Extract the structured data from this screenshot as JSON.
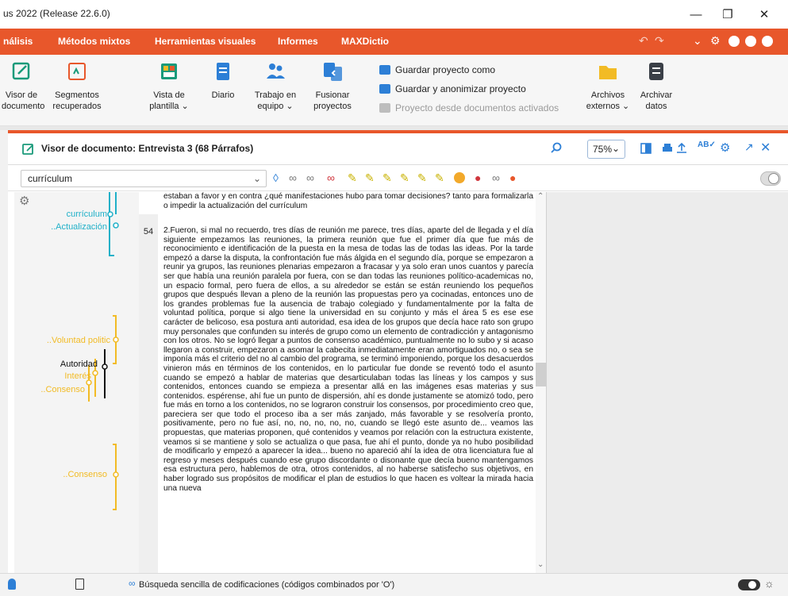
{
  "window": {
    "title": "us 2022 (Release 22.6.0)"
  },
  "menu": [
    "nálisis",
    "Métodos mixtos",
    "Herramientas visuales",
    "Informes",
    "MAXDictio"
  ],
  "ribbon": {
    "buttons": [
      {
        "line1": "Visor de",
        "line2": "documento"
      },
      {
        "line1": "Segmentos",
        "line2": "recuperados"
      },
      {
        "line1": "Vista de",
        "line2": "plantilla ⌄"
      },
      {
        "line1": "Diario",
        "line2": ""
      },
      {
        "line1": "Trabajo en",
        "line2": "equipo ⌄"
      },
      {
        "line1": "Fusionar",
        "line2": "proyectos"
      },
      {
        "line1": "Archivos",
        "line2": "externos ⌄"
      },
      {
        "line1": "Archivar",
        "line2": "datos"
      }
    ],
    "small": [
      "Guardar proyecto como",
      "Guardar y anonimizar proyecto",
      "Proyecto desde documentos activados"
    ]
  },
  "docbrowser": {
    "title": "Visor de documento: Entrevista 3   (68 Párrafos)",
    "zoom": "75%"
  },
  "codebar": {
    "selected_code": "currículum"
  },
  "stripes": {
    "labels": [
      "currículum",
      "..Actualización",
      "..Voluntad politic",
      "Autoridad",
      "Interés",
      "..Consenso",
      "..Consenso"
    ]
  },
  "colors": {
    "accent": "#e8572b",
    "cyan": "#1fb0c8",
    "yellow": "#f2bb25"
  },
  "text": {
    "para_prev": "estaban a favor y en contra ¿qué manifestaciones hubo para tomar decisiones? tanto para formalizarla o impedir la actualización del currículum",
    "para_num": "54",
    "para_main": "2.Fueron, si mal no recuerdo, tres días de reunión me parece, tres días, aparte del de llegada y el día siguiente empezamos las reuniones, la primera reunión que fue el primer día que fue más de reconocimiento e identificación de la puesta en la mesa de todas las de todas las ideas. Por la tarde empezó a darse la disputa, la confrontación fue más álgida en el segundo día, porque se empezaron a reunir ya grupos, las reuniones plenarias empezaron a fracasar y ya solo eran unos cuantos y parecía ser que había una reunión paralela por fuera, con se dan todas las reuniones político-academicas no, un espacio formal, pero fuera de ellos, a su alrededor se están se están reuniendo los pequeños grupos que después llevan a pleno de la reunión las propuestas pero ya cocinadas, entonces uno de los grandes problemas fue la ausencia de trabajo colegiado y fundamentalmente por la falta de voluntad política, porque si algo tiene la universidad en su conjunto y más el área 5 es ese ese carácter de belicoso, esa postura anti autoridad, esa idea de los grupos que decía hace rato son grupo muy personales que confunden su interés de grupo como un elemento de contradicción y antagonismo con los otros. No se logró llegar a puntos de consenso académico, puntualmente no lo subo y si acaso llegaron a construir, empezaron a asomar la cabecita inmediatamente eran amortiguados no, o sea se imponía más el criterio del no al cambio del programa, se terminó imponiendo, porque los desacuerdos vinieron más en términos de los contenidos, en lo particular fue donde se reventó todo el asunto cuando se empezó a hablar de materias que desarticulaban todas las líneas y los campos y sus contenidos, entonces cuando se empieza a presentar allá en las imágenes esas materias y sus contenidos. espérense, ahí fue un punto de dispersión, ahí es donde justamente se atomizó todo, pero fue más en torno a los contenidos, no se lograron construir los consensos, por procedimiento creo que, pareciera ser que todo el proceso iba a ser más zanjado, más favorable y se resolvería pronto, positivamente, pero no fue así, no, no, no, no, no, cuando se llegó este asunto de... veamos las propuestas, que materias proponen, qué contenidos y veamos por relación con la estructura existente, veamos si se mantiene y solo se actualiza o que pasa, fue ahí el punto, donde ya no hubo posibilidad de modificarlo y empezó a aparecer la idea... bueno no apareció ahí la idea de otra licenciatura fue al regreso y meses después cuando ese grupo discordante o disonante que decía bueno mantengamos esa estructura pero, hablemos de otra, otros contenidos, al no haberse satisfecho sus objetivos, en haber logrado sus propósitos de modificar el plan de estudios lo que hacen es voltear la mirada hacia una nueva"
  },
  "status": {
    "text": "Búsqueda sencilla de codificaciones (códigos combinados por 'O')"
  }
}
